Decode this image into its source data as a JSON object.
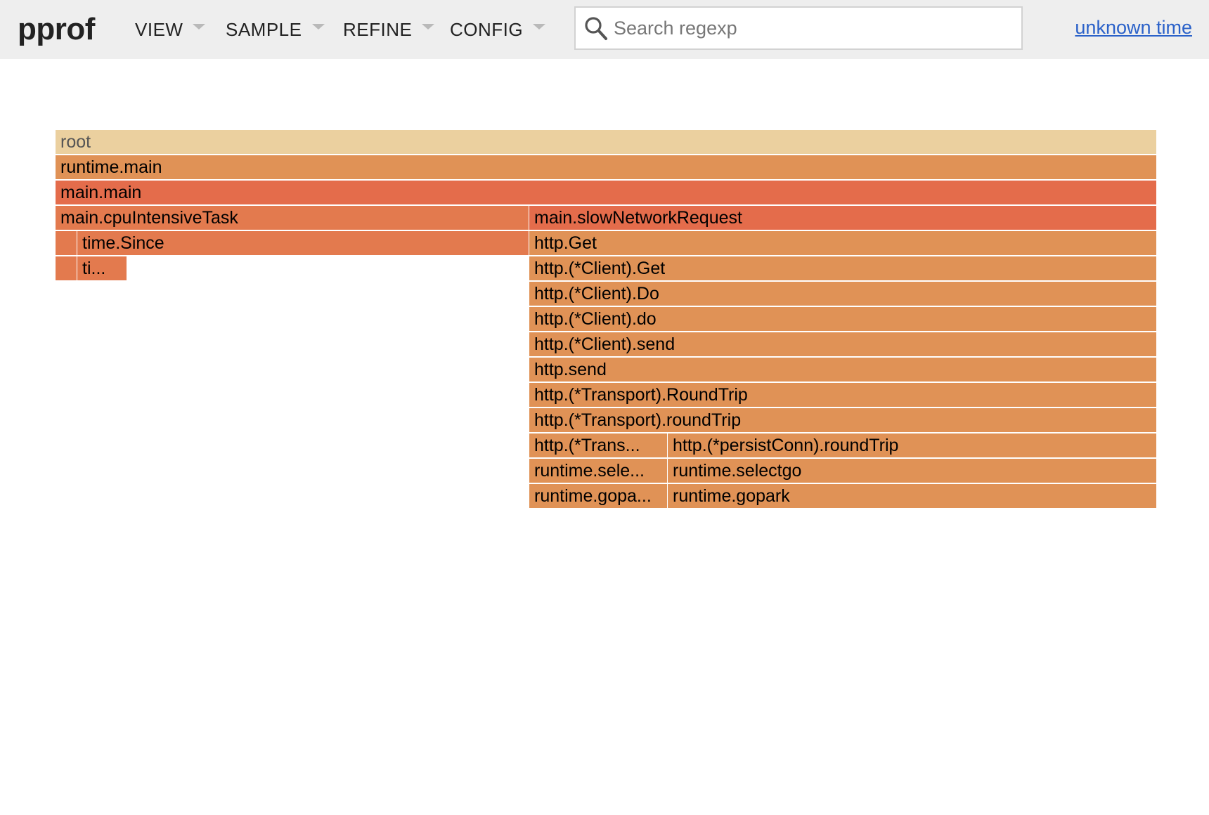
{
  "app": {
    "logo": "pprof",
    "time_link": "unknown time"
  },
  "menus": [
    {
      "label": "VIEW"
    },
    {
      "label": "SAMPLE"
    },
    {
      "label": "REFINE"
    },
    {
      "label": "CONFIG"
    }
  ],
  "search": {
    "placeholder": "Search regexp",
    "value": ""
  },
  "colors": {
    "topbar_bg": "#eeeeee",
    "link": "#2a61c9",
    "root": "#ebd09f",
    "light_orange": "#e09256",
    "medium_orange": "#e37a4e",
    "red_orange": "#e46c4b"
  },
  "flame": {
    "frames": [
      {
        "label": "root",
        "depth": 0,
        "start": 0.0,
        "end": 1.0,
        "color": "#ebd09f"
      },
      {
        "label": "runtime.main",
        "depth": 1,
        "start": 0.0,
        "end": 1.0,
        "color": "#e09256"
      },
      {
        "label": "main.main",
        "depth": 2,
        "start": 0.0,
        "end": 1.0,
        "color": "#e46c4b"
      },
      {
        "label": "main.cpuIntensiveTask",
        "depth": 3,
        "start": 0.0,
        "end": 0.43,
        "color": "#e37a4e"
      },
      {
        "label": "main.slowNetworkRequest",
        "depth": 3,
        "start": 0.43,
        "end": 1.0,
        "color": "#e46c4b"
      },
      {
        "label": "",
        "depth": 4,
        "start": 0.0,
        "end": 0.02,
        "color": "#e37a4e"
      },
      {
        "label": "time.Since",
        "depth": 4,
        "start": 0.02,
        "end": 0.43,
        "color": "#e37a4e"
      },
      {
        "label": "http.Get",
        "depth": 4,
        "start": 0.43,
        "end": 1.0,
        "color": "#e09256"
      },
      {
        "label": "",
        "depth": 5,
        "start": 0.0,
        "end": 0.02,
        "color": "#e37a4e"
      },
      {
        "label": "ti...",
        "depth": 5,
        "start": 0.02,
        "end": 0.065,
        "color": "#e37a4e"
      },
      {
        "label": "http.(*Client).Get",
        "depth": 5,
        "start": 0.43,
        "end": 1.0,
        "color": "#e09256"
      },
      {
        "label": "http.(*Client).Do",
        "depth": 6,
        "start": 0.43,
        "end": 1.0,
        "color": "#e09256"
      },
      {
        "label": "http.(*Client).do",
        "depth": 7,
        "start": 0.43,
        "end": 1.0,
        "color": "#e09256"
      },
      {
        "label": "http.(*Client).send",
        "depth": 8,
        "start": 0.43,
        "end": 1.0,
        "color": "#e09256"
      },
      {
        "label": "http.send",
        "depth": 9,
        "start": 0.43,
        "end": 1.0,
        "color": "#e09256"
      },
      {
        "label": "http.(*Transport).RoundTrip",
        "depth": 10,
        "start": 0.43,
        "end": 1.0,
        "color": "#e09256"
      },
      {
        "label": "http.(*Transport).roundTrip",
        "depth": 11,
        "start": 0.43,
        "end": 1.0,
        "color": "#e09256"
      },
      {
        "label": "http.(*Trans...",
        "depth": 12,
        "start": 0.43,
        "end": 0.556,
        "color": "#e09256"
      },
      {
        "label": "http.(*persistConn).roundTrip",
        "depth": 12,
        "start": 0.556,
        "end": 1.0,
        "color": "#e09256"
      },
      {
        "label": "runtime.sele...",
        "depth": 13,
        "start": 0.43,
        "end": 0.556,
        "color": "#e09256"
      },
      {
        "label": "runtime.selectgo",
        "depth": 13,
        "start": 0.556,
        "end": 1.0,
        "color": "#e09256"
      },
      {
        "label": "runtime.gopa...",
        "depth": 14,
        "start": 0.43,
        "end": 0.556,
        "color": "#e09256"
      },
      {
        "label": "runtime.gopark",
        "depth": 14,
        "start": 0.556,
        "end": 1.0,
        "color": "#e09256"
      }
    ]
  }
}
